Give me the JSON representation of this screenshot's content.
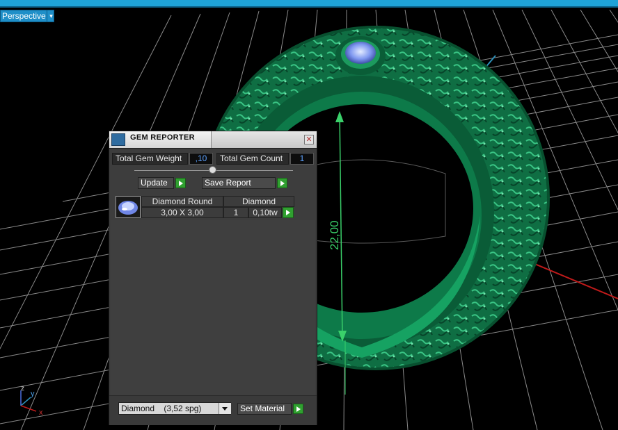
{
  "viewport": {
    "view_mode": "Perspective",
    "dimension": "22,00",
    "axes": {
      "z": "z",
      "y": "y",
      "x": "x"
    }
  },
  "gem_reporter": {
    "title": "GEM REPORTER",
    "total_weight_label": "Total Gem Weight",
    "total_weight_value": ",10",
    "total_count_label": "Total Gem Count",
    "total_count_value": "1",
    "update_label": "Update",
    "save_report_label": "Save Report",
    "gems": [
      {
        "shape": "Diamond Round",
        "material": "Diamond",
        "size": "3,00 X 3,00",
        "count": "1",
        "weight": "0,10tw"
      }
    ],
    "material_select": "Diamond    (3,52 spg)",
    "set_material_label": "Set Material"
  },
  "colors": {
    "ring": "#0f7a4a",
    "gem": "#8aa6ff",
    "dimension": "#3ad06a",
    "grid": "#8a8a8a",
    "red_axis": "#c01a1a",
    "blue_axis": "#2d8fb8",
    "title_bar": "#1fa3d8"
  }
}
